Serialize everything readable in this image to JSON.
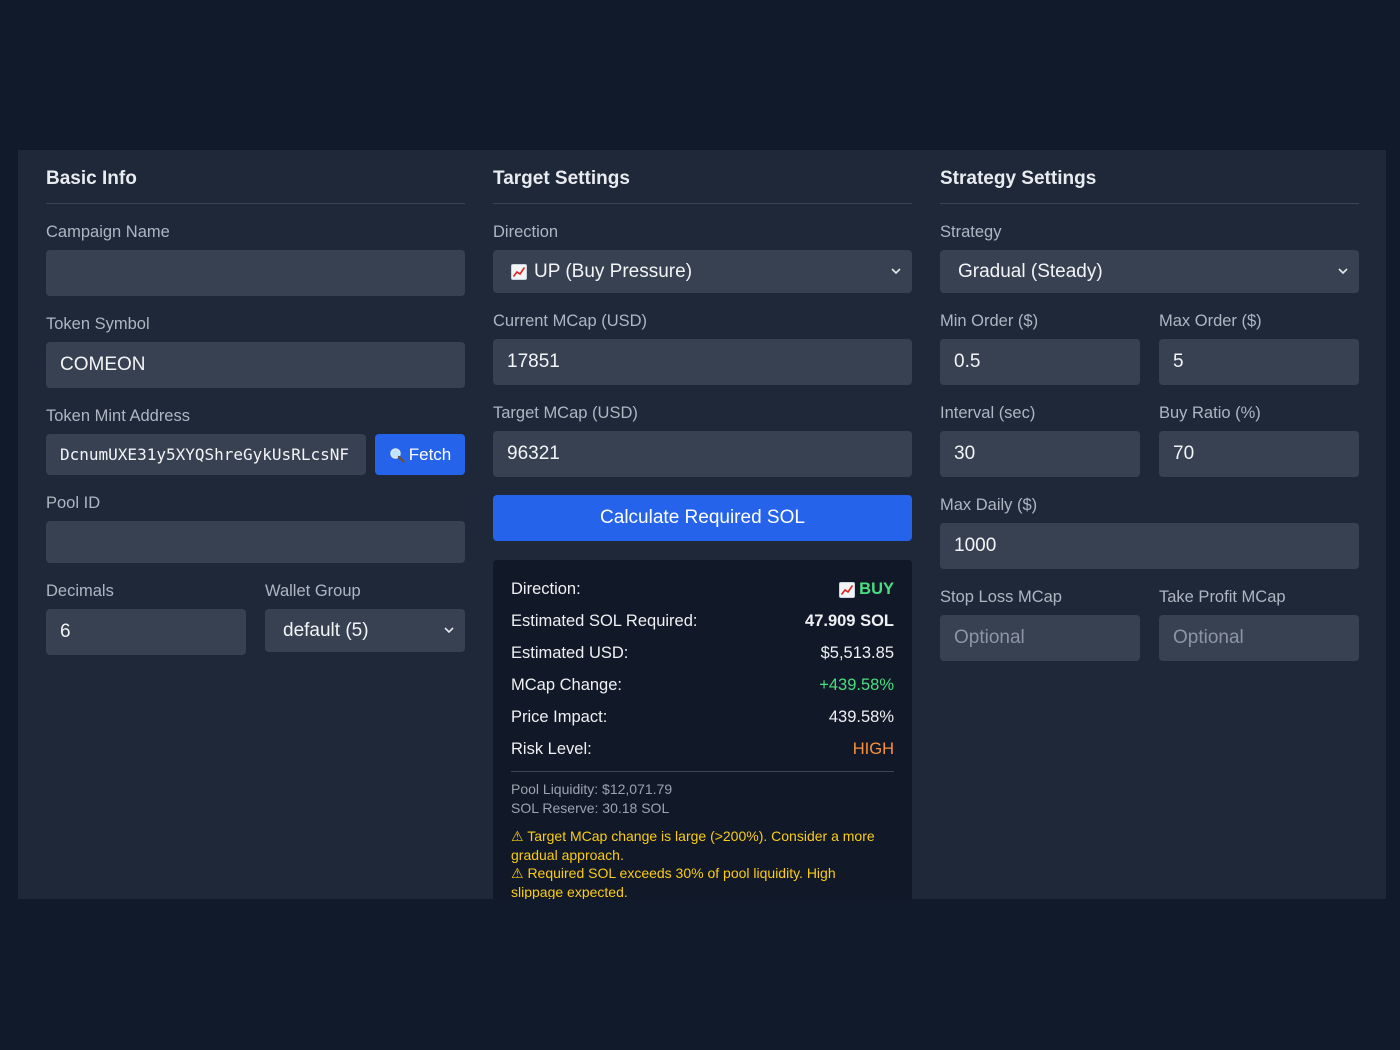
{
  "basic_info": {
    "title": "Basic Info",
    "campaign_name": {
      "label": "Campaign Name",
      "value": "",
      "placeholder": ""
    },
    "token_symbol": {
      "label": "Token Symbol",
      "value": "COMEON"
    },
    "token_mint": {
      "label": "Token Mint Address",
      "value": "DcnumUXE31y5XYQShreGykUsRLcsNF",
      "fetch_label": "Fetch",
      "fetch_icon": "magnifier-icon"
    },
    "pool_id": {
      "label": "Pool ID",
      "value": ""
    },
    "decimals": {
      "label": "Decimals",
      "value": "6"
    },
    "wallet_group": {
      "label": "Wallet Group",
      "selected": "default (5)"
    }
  },
  "target_settings": {
    "title": "Target Settings",
    "direction": {
      "label": "Direction",
      "selected": "UP (Buy Pressure)",
      "icon": "chart-up-icon"
    },
    "current_mcap": {
      "label": "Current MCap (USD)",
      "value": "17851"
    },
    "target_mcap": {
      "label": "Target MCap (USD)",
      "value": "96321"
    },
    "calculate_label": "Calculate Required SOL",
    "results": {
      "direction": {
        "label": "Direction:",
        "value": "BUY"
      },
      "est_sol": {
        "label": "Estimated SOL Required:",
        "value": "47.909 SOL"
      },
      "est_usd": {
        "label": "Estimated USD:",
        "value": "$5,513.85"
      },
      "mcap_change": {
        "label": "MCap Change:",
        "value": "+439.58%"
      },
      "price_impact": {
        "label": "Price Impact:",
        "value": "439.58%"
      },
      "risk_level": {
        "label": "Risk Level:",
        "value": "HIGH"
      },
      "pool_liquidity": "Pool Liquidity: $12,071.79",
      "sol_reserve": "SOL Reserve: 30.18 SOL",
      "warnings": [
        "⚠ Target MCap change is large (>200%). Consider a more gradual approach.",
        "⚠ Required SOL exceeds 30% of pool liquidity. High slippage expected."
      ]
    }
  },
  "strategy_settings": {
    "title": "Strategy Settings",
    "strategy": {
      "label": "Strategy",
      "selected": "Gradual (Steady)"
    },
    "min_order": {
      "label": "Min Order ($)",
      "value": "0.5"
    },
    "max_order": {
      "label": "Max Order ($)",
      "value": "5"
    },
    "interval": {
      "label": "Interval (sec)",
      "value": "30"
    },
    "buy_ratio": {
      "label": "Buy Ratio (%)",
      "value": "70"
    },
    "max_daily": {
      "label": "Max Daily ($)",
      "value": "1000"
    },
    "stop_loss": {
      "label": "Stop Loss MCap",
      "value": "",
      "placeholder": "Optional"
    },
    "take_profit": {
      "label": "Take Profit MCap",
      "value": "",
      "placeholder": "Optional"
    }
  },
  "colors": {
    "background": "#111a2b",
    "panel": "#1e2838",
    "field": "#374152",
    "accent": "#2563eb",
    "positive": "#4ade80",
    "risk": "#fb923c",
    "warning": "#facc15"
  }
}
